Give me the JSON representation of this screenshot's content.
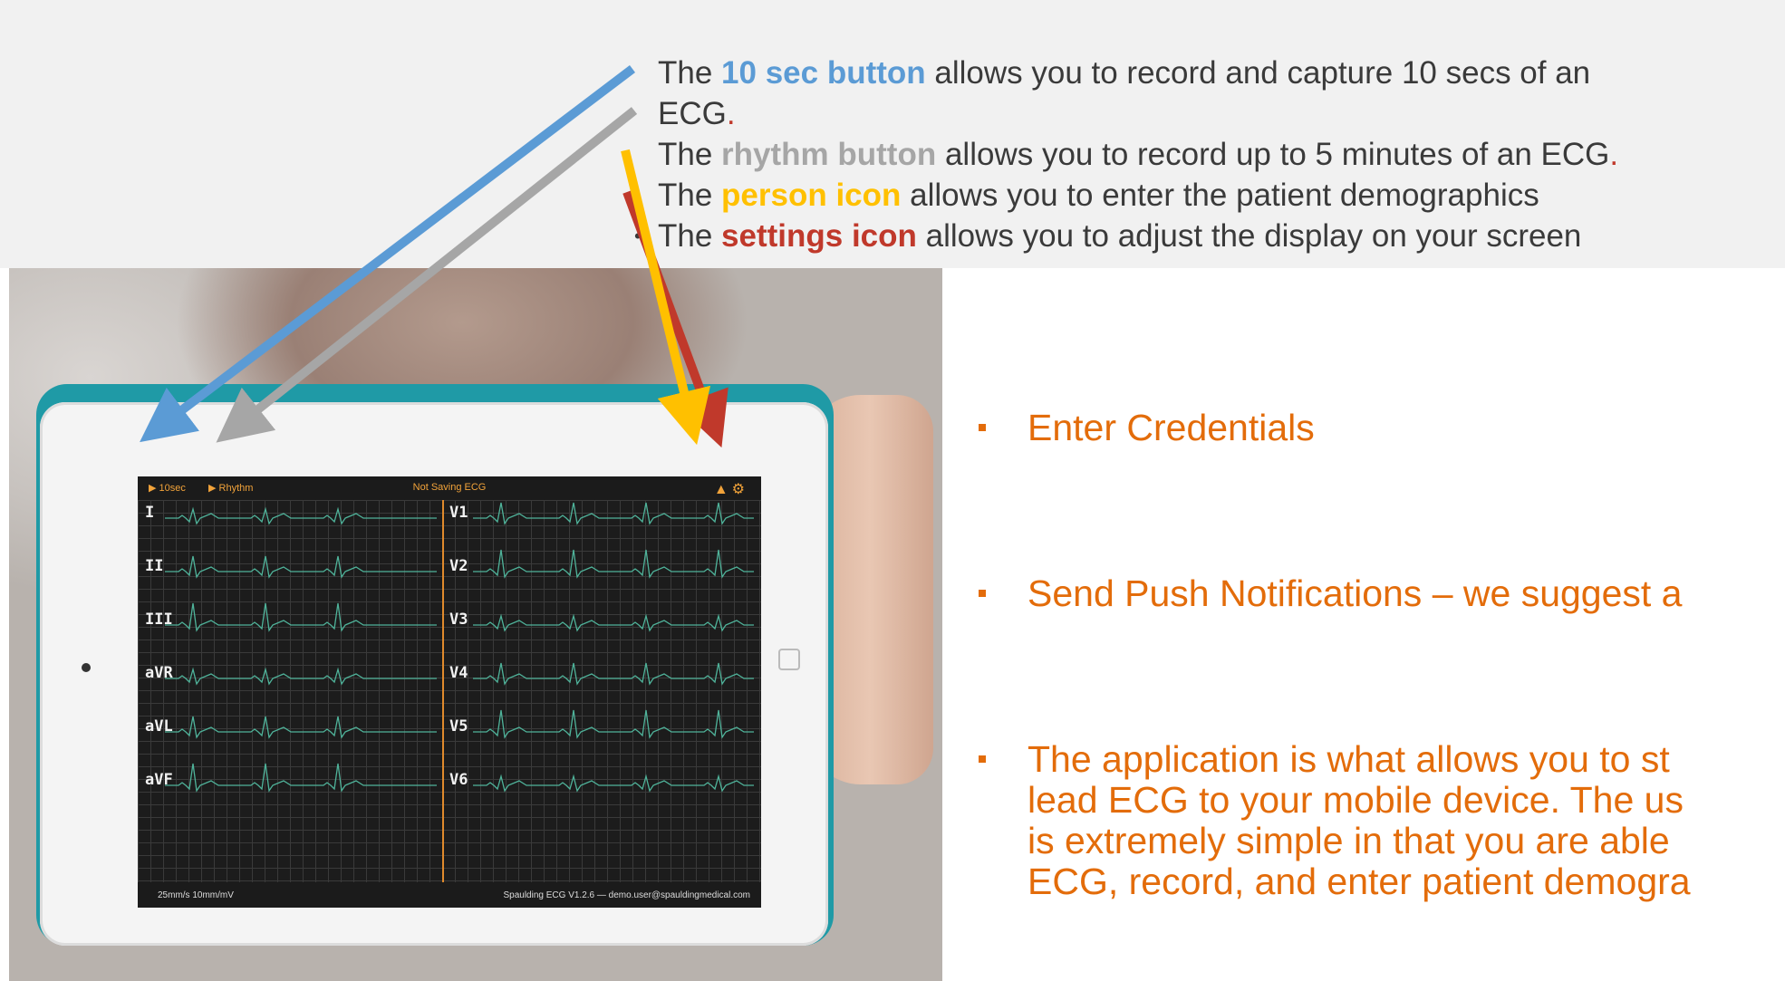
{
  "colors": {
    "blue": "#5b9bd5",
    "gray": "#a6a6a6",
    "yellow": "#ffc000",
    "red": "#c0392b",
    "orange_text": "#e36c0a",
    "case_teal": "#1f9aa6",
    "app_accent": "#f2a33a"
  },
  "caption": {
    "b1_pre": "The ",
    "b1_kw": "10 sec button",
    "b1_post": " allows you to record and capture 10 secs of an",
    "b1_cont": "ECG",
    "b1_end": ".",
    "b2_pre": "The ",
    "b2_kw": "rhythm button",
    "b2_post": " allows you to record up to 5 minutes of an ECG",
    "b2_end": ".",
    "b3_pre": "The ",
    "b3_kw": "person icon",
    "b3_post": " allows you to enter the patient demographics",
    "b4_pre": "The ",
    "b4_kw": "settings icon",
    "b4_post": " allows you to adjust the display on your screen"
  },
  "app": {
    "btn_10sec": "▶ 10sec",
    "btn_rhythm": "▶ Rhythm",
    "status": "Not Saving ECG",
    "icons": "⚲⚙",
    "leads_left": [
      "I",
      "II",
      "III",
      "aVR",
      "aVL",
      "aVF"
    ],
    "leads_right": [
      "V1",
      "V2",
      "V3",
      "V4",
      "V5",
      "V6"
    ],
    "footer_left": "25mm/s  10mm/mV",
    "footer_right": "Spaulding ECG V1.2.6 — demo.user@spauldingmedical.com"
  },
  "right_list": {
    "item1": "Enter Credentials",
    "item2": "Send Push Notifications – we suggest a",
    "item3_l1": "The application is what allows you to st",
    "item3_l2": "lead ECG to your mobile device. The us",
    "item3_l3": "is extremely simple in that you are able",
    "item3_l4": "ECG, record, and enter patient demogra"
  }
}
